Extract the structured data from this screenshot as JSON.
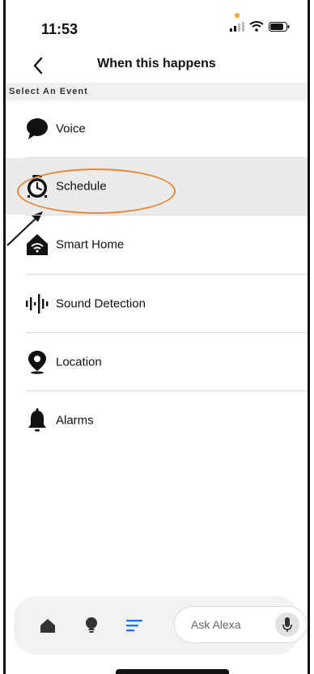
{
  "status": {
    "time": "11:53"
  },
  "header": {
    "title": "When this happens",
    "back_icon": "chevron-left-icon"
  },
  "section": {
    "label": "Select An Event"
  },
  "events": [
    {
      "label": "Voice",
      "icon": "speech-bubble-icon",
      "selected": false
    },
    {
      "label": "Schedule",
      "icon": "alarm-clock-icon",
      "selected": true
    },
    {
      "label": "Smart Home",
      "icon": "smart-home-icon",
      "selected": false
    },
    {
      "label": "Sound Detection",
      "icon": "sound-wave-icon",
      "selected": false
    },
    {
      "label": "Location",
      "icon": "location-pin-icon",
      "selected": false
    },
    {
      "label": "Alarms",
      "icon": "bell-icon",
      "selected": false
    }
  ],
  "bottom_nav": {
    "items": [
      "home-icon",
      "lightbulb-icon",
      "menu-icon"
    ],
    "active": "menu-icon",
    "ask_placeholder": "Ask Alexa"
  },
  "colors": {
    "accent": "#1a73e8",
    "highlight": "#e8873a",
    "selected_bg": "#ebebeb"
  }
}
